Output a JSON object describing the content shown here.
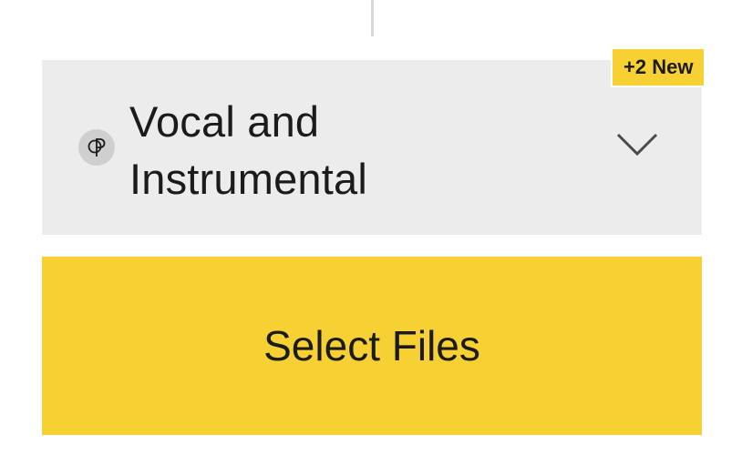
{
  "separator": {
    "color": "#d9d9d9"
  },
  "mode_dropdown": {
    "selected_label": "Vocal and Instrumental",
    "option_icon": "vocal-instrumental-icon",
    "chevron_icon": "chevron-down-icon",
    "background": "#ececec"
  },
  "new_badge": {
    "label": "+2 New",
    "background": "#f7d033"
  },
  "upload": {
    "button_label": "Select Files",
    "background": "#f7d033"
  }
}
